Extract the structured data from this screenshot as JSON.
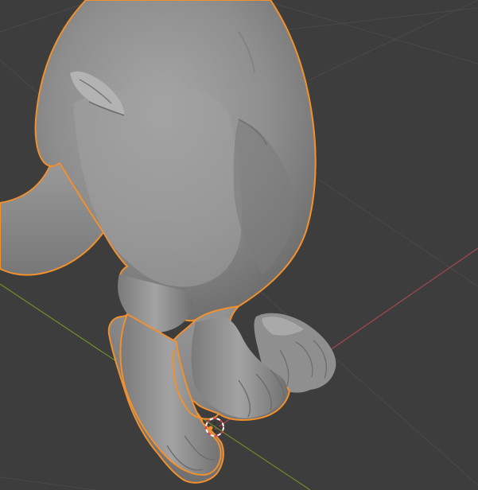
{
  "viewport": {
    "background": "#3d3d3d",
    "grid_color": "#4a4a4a",
    "x_axis_color": "#a8474f",
    "y_axis_color": "#6d8e2b",
    "selection_outline_color": "#f0902e",
    "mesh_color": "#8c8c8c",
    "cursor_colors": [
      "#ffffff",
      "#d8414a"
    ],
    "selected_object_origin_color": "#f0902e"
  }
}
